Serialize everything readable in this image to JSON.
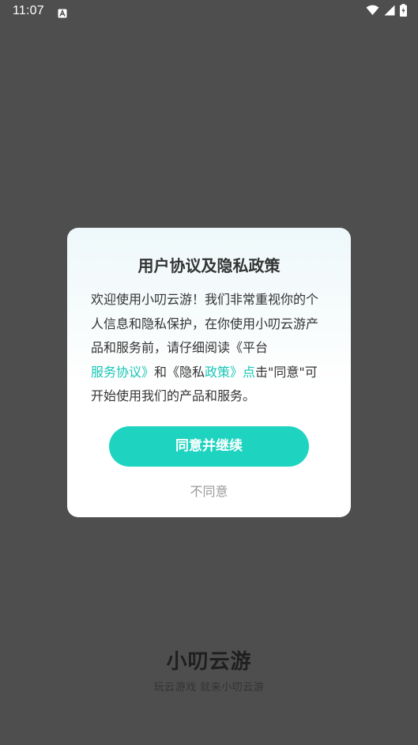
{
  "status_bar": {
    "time": "11:07",
    "icons": [
      "a-notification-icon",
      "wifi-icon",
      "signal-icon",
      "battery-icon"
    ]
  },
  "dialog": {
    "title": "用户协议及隐私政策",
    "body": {
      "text1": "欢迎使用小叨云游！我们非常重视你的个人信息和隐私保护，在你使用小叨云游产品和服务前，请仔细阅读《平台",
      "link1": "服务协议》",
      "text2": "和《隐私",
      "link2": "政策》点",
      "text3": "击\"同意\"可开始使用我们的产品和服务。"
    },
    "agree_label": "同意并继续",
    "disagree_label": "不同意"
  },
  "brand": {
    "logo": "小叨云游",
    "slogan": "玩云游戏 就来小叨云游"
  },
  "colors": {
    "accent": "#1ed4c0",
    "link": "#18c6b6",
    "overlay": "#4e4e4e"
  }
}
